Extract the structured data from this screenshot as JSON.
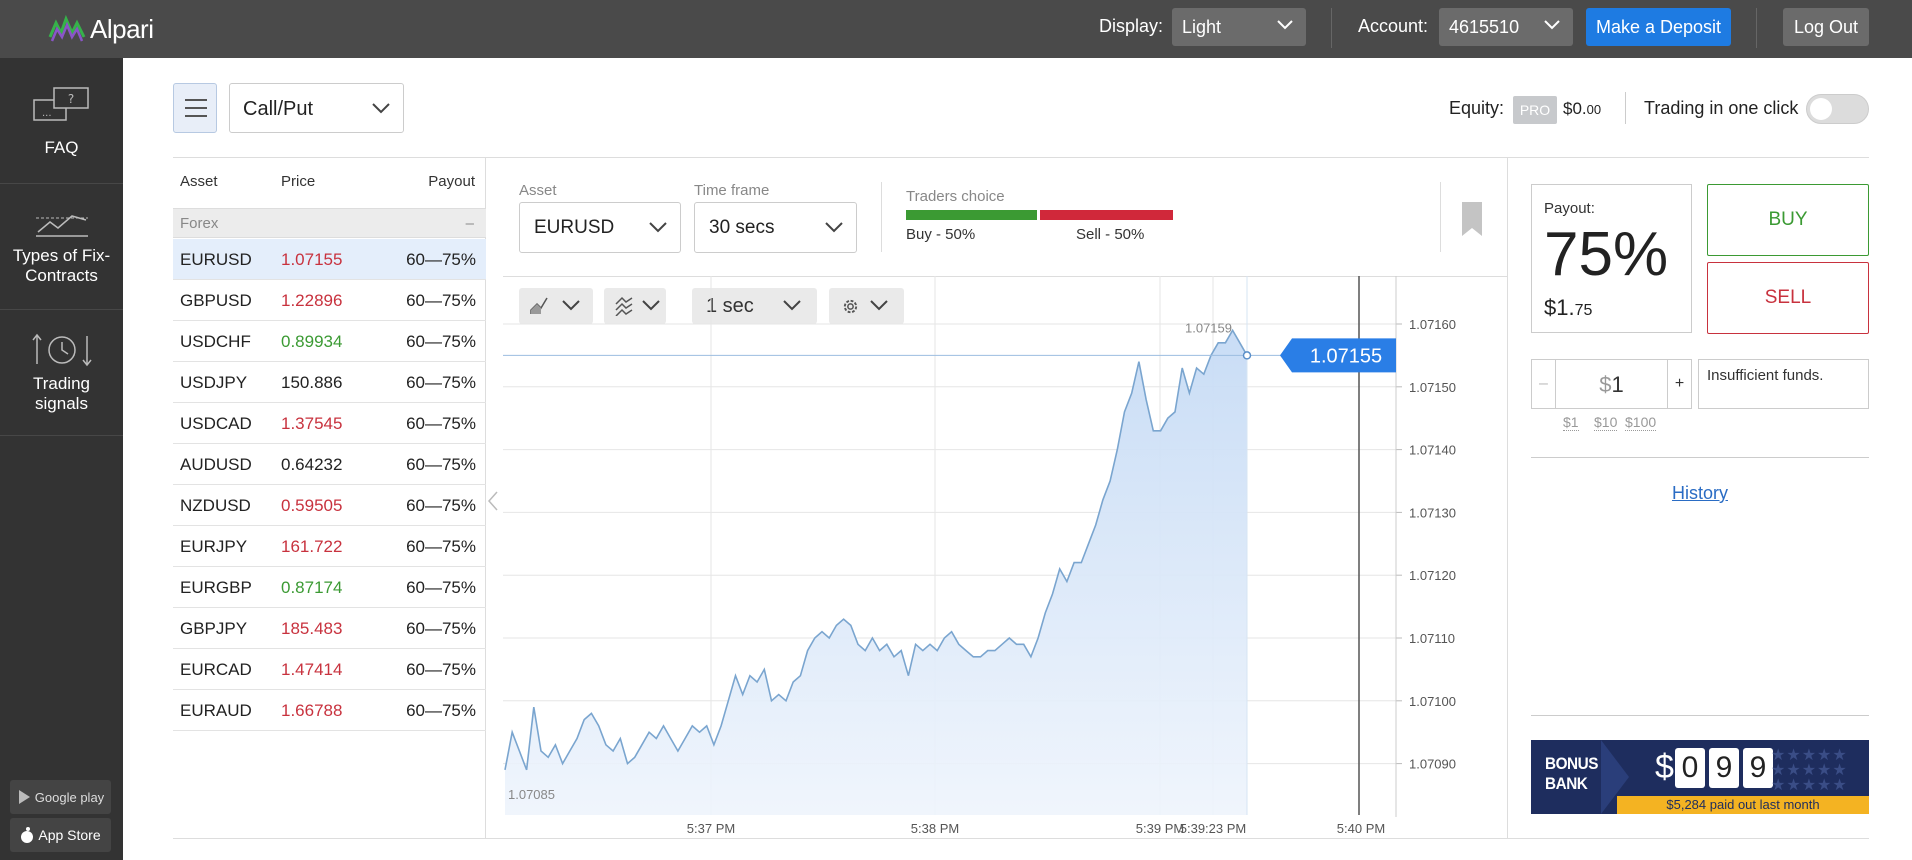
{
  "header": {
    "logo_text": "Alpari",
    "display_label": "Display:",
    "display_value": "Light",
    "account_label": "Account:",
    "account_value": "4615510",
    "deposit_label": "Make a Deposit",
    "logout_label": "Log Out"
  },
  "sidebar": {
    "items": [
      {
        "label": "FAQ",
        "icon": "faq-chat-icon"
      },
      {
        "label": "Types of Fix-Contracts",
        "icon": "contracts-chart-icon"
      },
      {
        "label": "Trading signals",
        "icon": "signals-clock-icon"
      }
    ],
    "google_play": "Google play",
    "app_store": "App Store"
  },
  "toolbar": {
    "contract_type": "Call/Put",
    "equity_label": "Equity:",
    "pro_badge": "PRO",
    "equity_main": "$0.",
    "equity_cents": "00",
    "one_click_label": "Trading in one click",
    "one_click_on": false
  },
  "asset_list": {
    "headers": {
      "asset": "Asset",
      "price": "Price",
      "payout": "Payout"
    },
    "group": {
      "name": "Forex",
      "dash": "–"
    },
    "rows": [
      {
        "symbol": "EURUSD",
        "price": "1.07155",
        "color": "red",
        "payout": "60—75%",
        "selected": true
      },
      {
        "symbol": "GBPUSD",
        "price": "1.22896",
        "color": "red",
        "payout": "60—75%"
      },
      {
        "symbol": "USDCHF",
        "price": "0.89934",
        "color": "green",
        "payout": "60—75%"
      },
      {
        "symbol": "USDJPY",
        "price": "150.886",
        "color": "black",
        "payout": "60—75%"
      },
      {
        "symbol": "USDCAD",
        "price": "1.37545",
        "color": "red",
        "payout": "60—75%"
      },
      {
        "symbol": "AUDUSD",
        "price": "0.64232",
        "color": "black",
        "payout": "60—75%"
      },
      {
        "symbol": "NZDUSD",
        "price": "0.59505",
        "color": "red",
        "payout": "60—75%"
      },
      {
        "symbol": "EURJPY",
        "price": "161.722",
        "color": "red",
        "payout": "60—75%"
      },
      {
        "symbol": "EURGBP",
        "price": "0.87174",
        "color": "green",
        "payout": "60—75%"
      },
      {
        "symbol": "GBPJPY",
        "price": "185.483",
        "color": "red",
        "payout": "60—75%"
      },
      {
        "symbol": "EURCAD",
        "price": "1.47414",
        "color": "red",
        "payout": "60—75%"
      },
      {
        "symbol": "EURAUD",
        "price": "1.66788",
        "color": "red",
        "payout": "60—75%"
      }
    ]
  },
  "chart_header": {
    "asset_label": "Asset",
    "asset_value": "EURUSD",
    "timeframe_label": "Time frame",
    "timeframe_value": "30 secs",
    "traders_choice_label": "Traders choice",
    "buy_text": "Buy - 50%",
    "sell_text": "Sell - 50%",
    "buy_pct": 50,
    "sell_pct": 50,
    "tick_interval": "1 sec"
  },
  "chart_data": {
    "type": "area",
    "symbol": "EURUSD",
    "current_price": "1.07155",
    "max_label": "1.07159",
    "min_label": "1.07085",
    "y_ticks": [
      "1.07160",
      "1.07150",
      "1.07140",
      "1.07130",
      "1.07120",
      "1.07110",
      "1.07100",
      "1.07090"
    ],
    "x_ticks": [
      "5:37 PM",
      "5:38 PM",
      "5:39 PM",
      "5:39:23 PM",
      "5:40 PM"
    ],
    "ylim": [
      1.07085,
      1.07162
    ],
    "grid": true,
    "series": [
      {
        "values": [
          1.07089,
          1.07095,
          1.07092,
          1.07089,
          1.07099,
          1.07092,
          1.07091,
          1.07093,
          1.0709,
          1.07092,
          1.07094,
          1.07097,
          1.07098,
          1.07096,
          1.07093,
          1.07092,
          1.07094,
          1.0709,
          1.07091,
          1.07093,
          1.07095,
          1.07094,
          1.07096,
          1.07094,
          1.07092,
          1.07094,
          1.07096,
          1.07095,
          1.07096,
          1.07093,
          1.07096,
          1.071,
          1.07104,
          1.07101,
          1.07104,
          1.07103,
          1.07105,
          1.071,
          1.07101,
          1.071,
          1.07103,
          1.07104,
          1.07108,
          1.0711,
          1.07111,
          1.0711,
          1.07112,
          1.07113,
          1.07112,
          1.07109,
          1.07108,
          1.0711,
          1.07108,
          1.07109,
          1.07107,
          1.07108,
          1.07104,
          1.07109,
          1.07108,
          1.07109,
          1.07108,
          1.0711,
          1.07111,
          1.07109,
          1.07108,
          1.07107,
          1.07107,
          1.07108,
          1.07108,
          1.07109,
          1.0711,
          1.07109,
          1.07109,
          1.07107,
          1.0711,
          1.07114,
          1.07117,
          1.07121,
          1.07119,
          1.07122,
          1.07122,
          1.07125,
          1.07128,
          1.07132,
          1.07135,
          1.0714,
          1.07146,
          1.07149,
          1.07154,
          1.07148,
          1.07143,
          1.07143,
          1.07145,
          1.07146,
          1.07153,
          1.07149,
          1.07153,
          1.07152,
          1.07155,
          1.07157,
          1.07157,
          1.07159,
          1.07157,
          1.07155
        ]
      }
    ]
  },
  "trade_panel": {
    "payout_label": "Payout:",
    "payout_pct": "75%",
    "payout_amt_main": "$1.",
    "payout_amt_cents": "75",
    "buy_label": "BUY",
    "sell_label": "SELL",
    "minus": "–",
    "plus": "+",
    "amount_currency": "$",
    "amount_value": "1",
    "quick_amounts": [
      "$1",
      "$10",
      "$100"
    ],
    "insufficient": "Insufficient funds.",
    "history_label": "History"
  },
  "bonus": {
    "title_line1": "BONUS",
    "title_line2": "BANK",
    "currency": "$",
    "digits": [
      "0",
      "9",
      "9"
    ],
    "paid_text": "$5,284 paid out last month"
  },
  "colors": {
    "header_bg": "#4a4a4a",
    "sidebar_bg": "#333333",
    "accent_blue": "#1e7be2",
    "buy_green": "#3b9a33",
    "sell_red": "#c8323e",
    "chart_line": "#7aa5cf"
  }
}
